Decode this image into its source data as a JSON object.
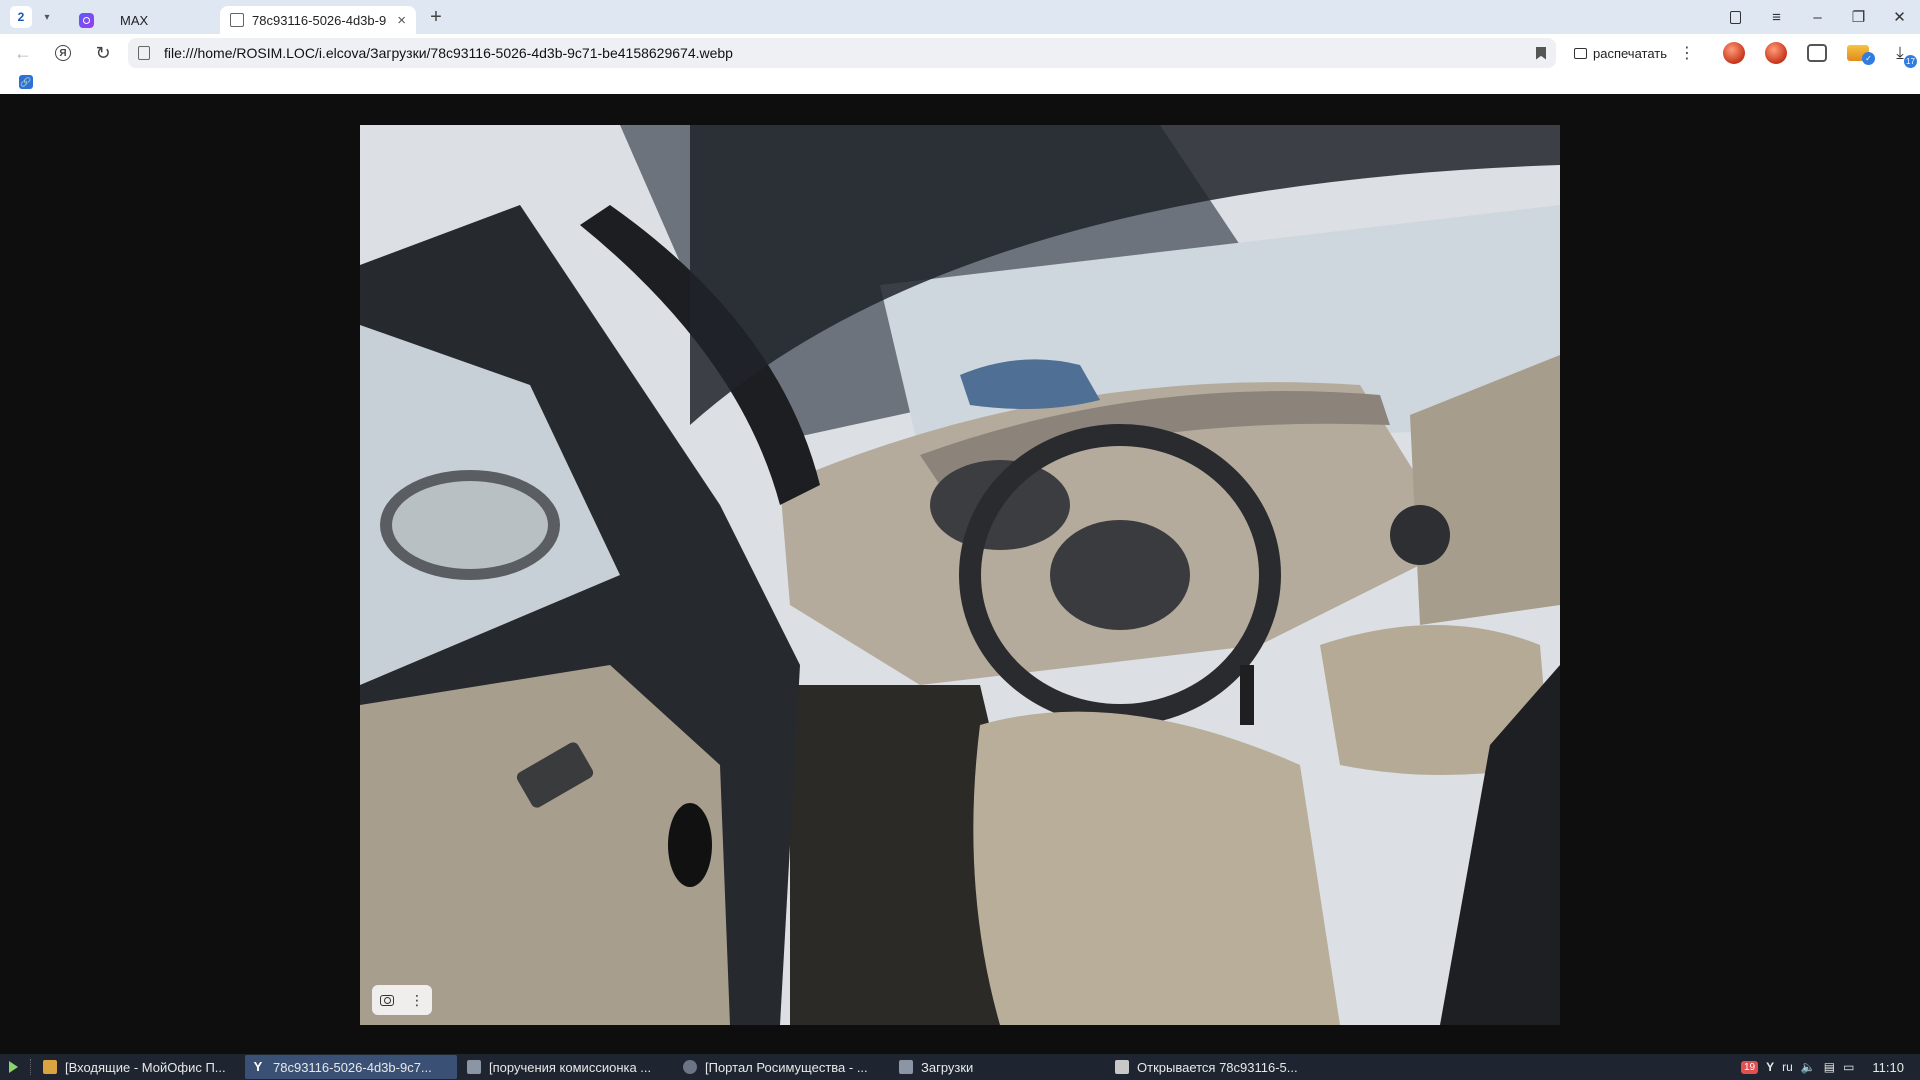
{
  "browser": {
    "tab_count": "2",
    "tabs": [
      {
        "label": "",
        "icon": "messenger-icon"
      },
      {
        "label": "MAX",
        "icon": ""
      },
      {
        "label": "78c93116-5026-4d3b-9",
        "icon": "image-file-icon"
      }
    ],
    "address": "file:///home/ROSIM.LOC/i.elcova/Загрузки/78c93116-5026-4d3b-9c71-be4158629674.webp",
    "print_label": "распечатать",
    "download_badge": "17"
  },
  "taskbar": {
    "tasks": [
      {
        "label": "[Входящие - МойОфис П...",
        "icon": "mail-icon"
      },
      {
        "label": "78c93116-5026-4d3b-9c7...",
        "icon": "yandex-browser-icon"
      },
      {
        "label": "[поручения комиссионка ...",
        "icon": "folder-icon"
      },
      {
        "label": "[Портал Росимущества - ...",
        "icon": "browser-icon"
      },
      {
        "label": "Загрузки",
        "icon": "folder-icon"
      },
      {
        "label": "Открывается 78c93116-5...",
        "icon": "document-icon"
      }
    ],
    "tray": {
      "calendar_badge": "19",
      "language": "ru",
      "clock": "11:10"
    }
  },
  "colors": {
    "tab_strip": "#dfe7f3",
    "taskbar": "#1e2530",
    "viewport": "#0e0e0e",
    "active_task": "#3a5175"
  }
}
